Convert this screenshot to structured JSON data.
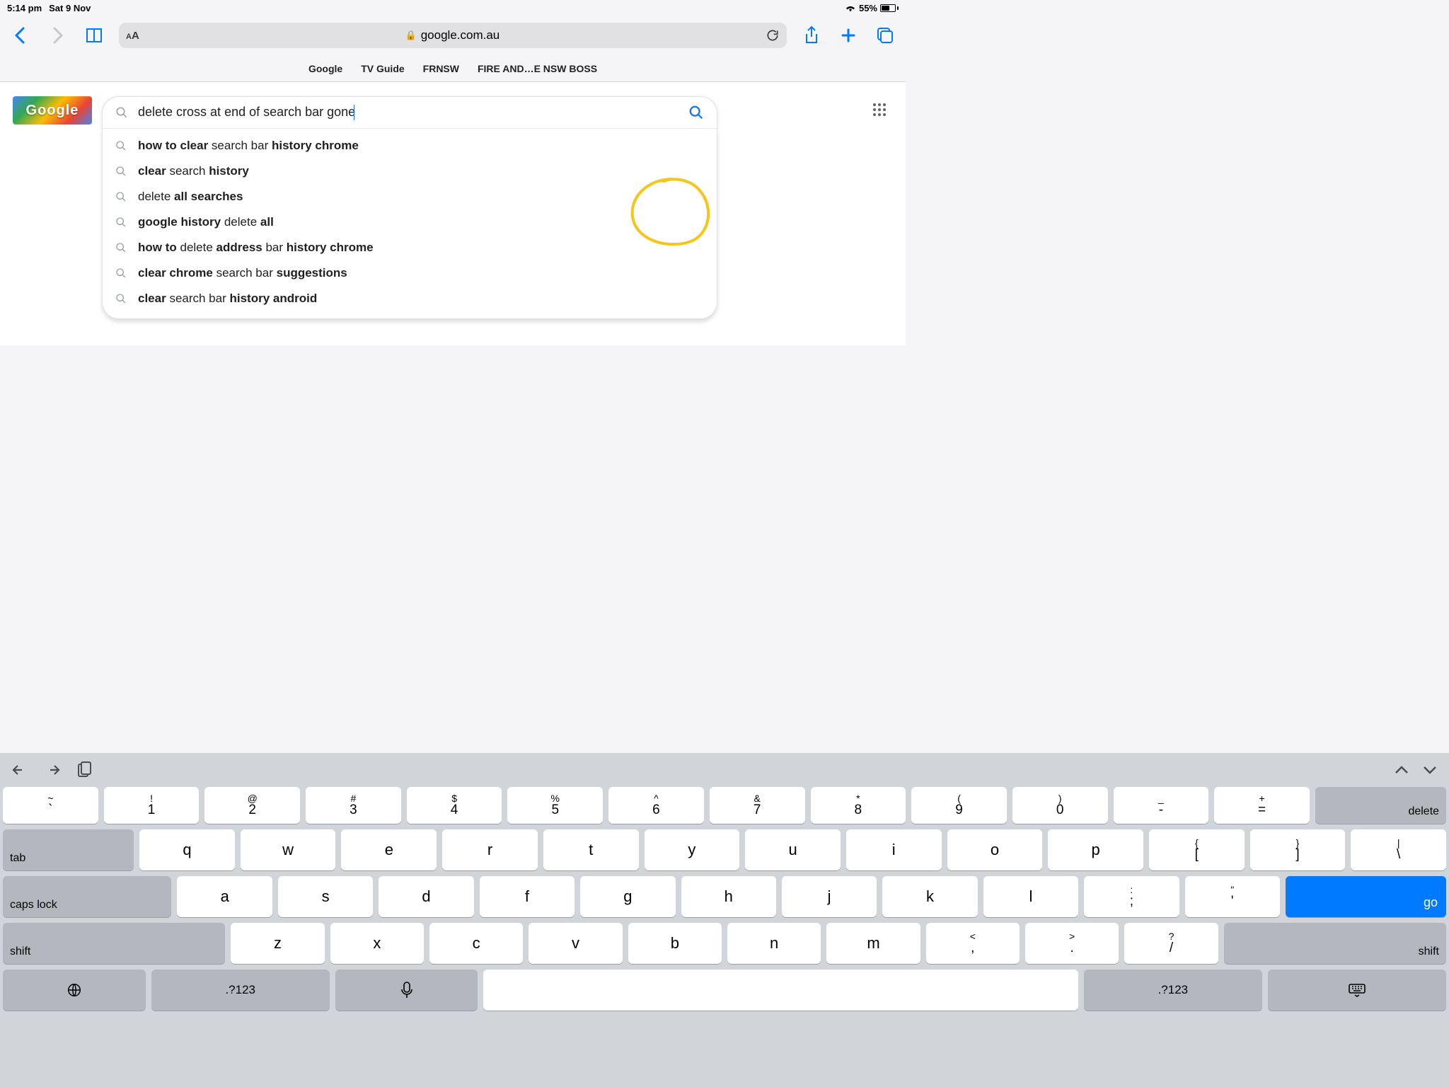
{
  "status": {
    "time": "5:14 pm",
    "date": "Sat 9 Nov",
    "battery_pct": "55%"
  },
  "safari": {
    "domain": "google.com.au",
    "favorites": [
      "Google",
      "TV Guide",
      "FRNSW",
      "FIRE AND…E NSW BOSS"
    ]
  },
  "google": {
    "logo_text": "Google",
    "search_query": "delete cross at end of search bar gone",
    "suggestions": [
      [
        [
          "how to clear ",
          true
        ],
        [
          "search bar ",
          false
        ],
        [
          "history chrome",
          true
        ]
      ],
      [
        [
          "clear ",
          true
        ],
        [
          "search ",
          false
        ],
        [
          "history",
          true
        ]
      ],
      [
        [
          "delete ",
          false
        ],
        [
          "all searches",
          true
        ]
      ],
      [
        [
          "google history ",
          true
        ],
        [
          "delete ",
          false
        ],
        [
          "all",
          true
        ]
      ],
      [
        [
          "how to ",
          true
        ],
        [
          "delete ",
          false
        ],
        [
          "address ",
          true
        ],
        [
          "bar ",
          false
        ],
        [
          "history chrome",
          true
        ]
      ],
      [
        [
          "clear chrome ",
          true
        ],
        [
          "search bar ",
          false
        ],
        [
          "suggestions",
          true
        ]
      ],
      [
        [
          "clear ",
          true
        ],
        [
          "search bar ",
          false
        ],
        [
          "history android",
          true
        ]
      ]
    ]
  },
  "keyboard": {
    "row1": [
      {
        "u": "~",
        "l": "`"
      },
      {
        "u": "!",
        "l": "1"
      },
      {
        "u": "@",
        "l": "2"
      },
      {
        "u": "#",
        "l": "3"
      },
      {
        "u": "$",
        "l": "4"
      },
      {
        "u": "%",
        "l": "5"
      },
      {
        "u": "^",
        "l": "6"
      },
      {
        "u": "&",
        "l": "7"
      },
      {
        "u": "*",
        "l": "8"
      },
      {
        "u": "(",
        "l": "9"
      },
      {
        "u": ")",
        "l": "0"
      },
      {
        "u": "_",
        "l": "-"
      },
      {
        "u": "+",
        "l": "="
      }
    ],
    "delete_label": "delete",
    "row2": [
      "q",
      "w",
      "e",
      "r",
      "t",
      "y",
      "u",
      "i",
      "o",
      "p"
    ],
    "row2_sym": [
      {
        "u": "{",
        "l": "["
      },
      {
        "u": "}",
        "l": "]"
      },
      {
        "u": "|",
        "l": "\\"
      }
    ],
    "tab_label": "tab",
    "row3": [
      "a",
      "s",
      "d",
      "f",
      "g",
      "h",
      "j",
      "k",
      "l"
    ],
    "row3_sym": [
      {
        "u": ":",
        "l": ";"
      },
      {
        "u": "\"",
        "l": "'"
      }
    ],
    "caps_label": "caps lock",
    "go_label": "go",
    "row4": [
      "z",
      "x",
      "c",
      "v",
      "b",
      "n",
      "m"
    ],
    "row4_sym": [
      {
        "u": "<",
        "l": ","
      },
      {
        "u": ">",
        "l": "."
      },
      {
        "u": "?",
        "l": "/"
      }
    ],
    "shift_label": "shift",
    "numswitch": ".?123"
  }
}
